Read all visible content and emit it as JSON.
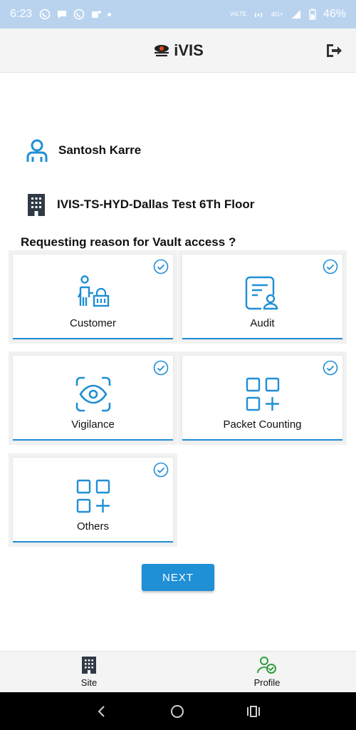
{
  "status": {
    "time": "6:23",
    "battery": "46%",
    "network": "4G+",
    "volte": "VoLTE"
  },
  "app": {
    "title": "iVIS"
  },
  "user": {
    "name": "Santosh Karre"
  },
  "site": {
    "name": "IVIS-TS-HYD-Dallas Test 6Th Floor"
  },
  "question": "Requesting reason for Vault access ?",
  "reasons": [
    {
      "label": "Customer",
      "icon": "customer-basket-icon",
      "checked": true
    },
    {
      "label": "Audit",
      "icon": "audit-document-icon",
      "checked": true
    },
    {
      "label": "Vigilance",
      "icon": "eye-scan-icon",
      "checked": true
    },
    {
      "label": "Packet Counting",
      "icon": "grid-plus-icon",
      "checked": true
    },
    {
      "label": "Others",
      "icon": "grid-plus-icon",
      "checked": true
    }
  ],
  "next_label": "NEXT",
  "nav": {
    "site": "Site",
    "profile": "Profile"
  },
  "colors": {
    "accent": "#1f8fd6",
    "profile_green": "#2e9d3c",
    "dark_icon": "#2f3a45"
  }
}
